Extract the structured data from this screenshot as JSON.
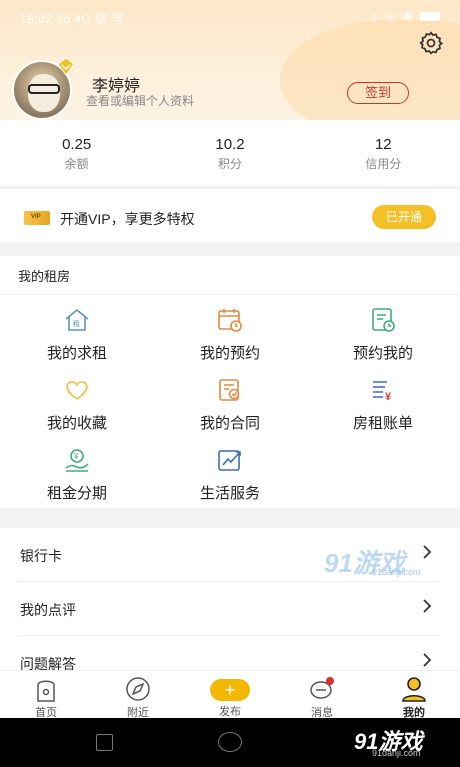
{
  "status_bar": {
    "time": "18:02 3d 4G 信 号"
  },
  "profile": {
    "name": "李婷婷",
    "subtitle": "查看或编辑个人资料",
    "signin_label": "签到"
  },
  "stats": [
    {
      "value": "0.25",
      "label": "余额"
    },
    {
      "value": "10.2",
      "label": "积分"
    },
    {
      "value": "12",
      "label": "信用分"
    }
  ],
  "vip": {
    "card_text": "VIP",
    "text": "开通VIP，享更多特权",
    "button": "已开通"
  },
  "rent": {
    "title": "我的租房",
    "items": [
      {
        "label": "我的求租",
        "icon": "house-icon"
      },
      {
        "label": "我的预约",
        "icon": "calendar-clock-icon"
      },
      {
        "label": "预约我的",
        "icon": "document-clock-icon"
      },
      {
        "label": "我的收藏",
        "icon": "heart-icon"
      },
      {
        "label": "我的合同",
        "icon": "contract-icon"
      },
      {
        "label": "房租账单",
        "icon": "bill-yen-icon"
      },
      {
        "label": "租金分期",
        "icon": "hand-money-icon"
      },
      {
        "label": "生活服务",
        "icon": "chart-trend-icon"
      }
    ]
  },
  "list": [
    {
      "label": "银行卡"
    },
    {
      "label": "我的点评"
    },
    {
      "label": "问题解答"
    }
  ],
  "tabbar": [
    {
      "label": "首页",
      "icon": "home-icon"
    },
    {
      "label": "附近",
      "icon": "compass-icon"
    },
    {
      "label": "发布",
      "icon": "plus-icon"
    },
    {
      "label": "消息",
      "icon": "message-icon"
    },
    {
      "label": "我的",
      "icon": "user-icon"
    }
  ],
  "watermark": {
    "brand": "91游戏",
    "site": "91danji.com"
  },
  "colors": {
    "accent": "#f5c027",
    "signin": "#c5362e",
    "icon_blue": "#5b93c9",
    "icon_orange": "#e58a3e",
    "icon_green": "#3fae78",
    "icon_yellow": "#f0c040"
  }
}
